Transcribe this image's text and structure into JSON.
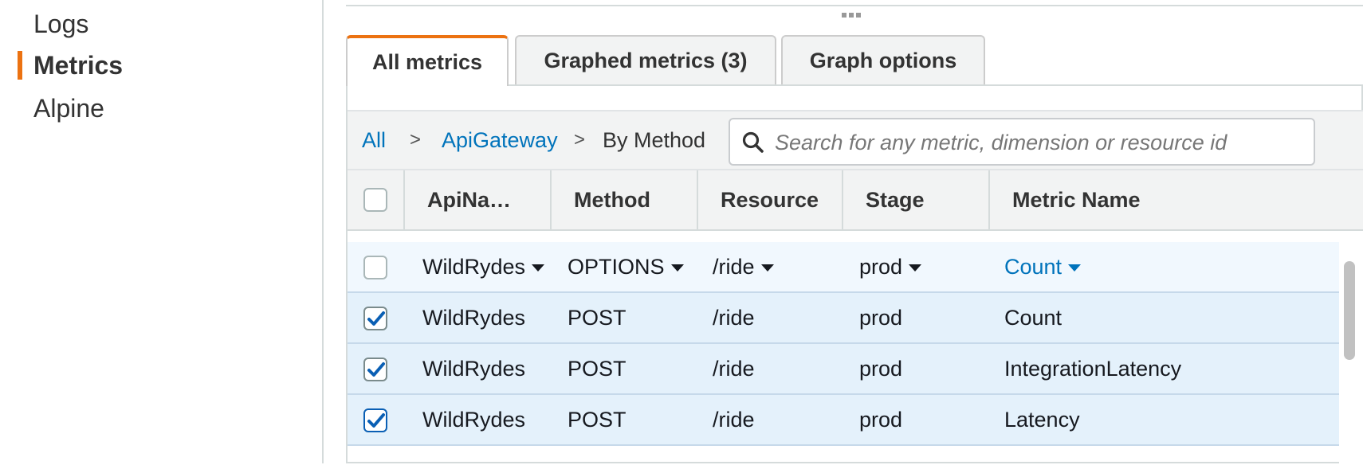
{
  "sidebar": {
    "items": [
      {
        "label": "Logs",
        "active": false
      },
      {
        "label": "Metrics",
        "active": true
      },
      {
        "label": "Alpine",
        "active": false
      }
    ]
  },
  "tabs": [
    {
      "label": "All metrics",
      "active": true
    },
    {
      "label": "Graphed metrics (3)",
      "active": false
    },
    {
      "label": "Graph options",
      "active": false
    }
  ],
  "breadcrumb": {
    "items": [
      {
        "label": "All",
        "link": true
      },
      {
        "label": "ApiGateway",
        "link": true
      },
      {
        "label": "By Method",
        "link": false
      }
    ],
    "separator": ">"
  },
  "search": {
    "placeholder": "Search for any metric, dimension or resource id",
    "value": ""
  },
  "table": {
    "columns": [
      "ApiNa…",
      "Method",
      "Resource",
      "Stage",
      "Metric Name"
    ],
    "rows": [
      {
        "checked": false,
        "api": "WildRydes",
        "method": "OPTIONS",
        "resource": "/ride",
        "stage": "prod",
        "metric": "Count"
      },
      {
        "checked": true,
        "api": "WildRydes",
        "method": "POST",
        "resource": "/ride",
        "stage": "prod",
        "metric": "Count"
      },
      {
        "checked": true,
        "api": "WildRydes",
        "method": "POST",
        "resource": "/ride",
        "stage": "prod",
        "metric": "IntegrationLatency"
      },
      {
        "checked": true,
        "api": "WildRydes",
        "method": "POST",
        "resource": "/ride",
        "stage": "prod",
        "metric": "Latency"
      }
    ]
  },
  "colors": {
    "accent": "#ec7211",
    "link": "#0073bb",
    "check": "#0a5fb4"
  }
}
